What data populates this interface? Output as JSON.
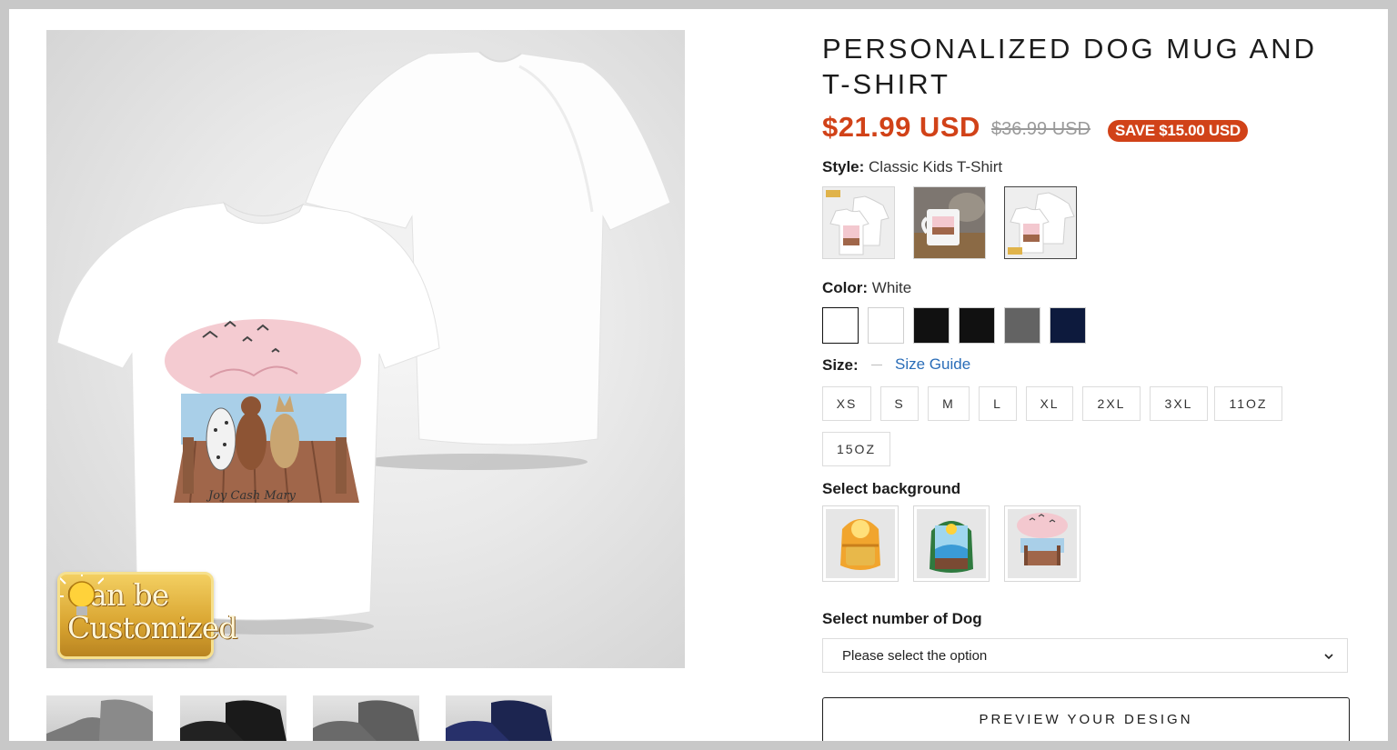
{
  "product": {
    "title": "PERSONALIZED DOG MUG AND T-SHIRT",
    "price_sale": "$21.99 USD",
    "price_compare": "$36.99 USD",
    "save_badge": "SAVE $15.00 USD"
  },
  "badge": {
    "line1": "Can be",
    "line2": "Customized"
  },
  "tshirt_art": {
    "names": "Joy Cash Mary"
  },
  "style": {
    "label": "Style:",
    "value": "Classic Kids T-Shirt",
    "options": [
      "classic-kids-t-shirt",
      "mug",
      "t-shirt-set"
    ],
    "selected_index": 2
  },
  "color": {
    "label": "Color:",
    "value": "White",
    "swatches": [
      "#ffffff",
      "#ffffff",
      "#111111",
      "#111111",
      "#636363",
      "#0d1a3d"
    ],
    "selected_index": 0
  },
  "size": {
    "label": "Size:",
    "guide_label": "Size Guide",
    "options": [
      "XS",
      "S",
      "M",
      "L",
      "XL",
      "2XL",
      "3XL",
      "11OZ",
      "15OZ"
    ]
  },
  "background": {
    "label": "Select background",
    "options": [
      "sunset-backpack",
      "mountain-lake-backpack",
      "pink-sky-dock"
    ]
  },
  "dog_count": {
    "label": "Select number of Dog",
    "placeholder": "Please select the option"
  },
  "preview_button": "PREVIEW YOUR DESIGN",
  "thumbnails": [
    "gray",
    "black",
    "dark-gray",
    "navy"
  ],
  "colors": {
    "accent_red": "#d14218",
    "link_blue": "#2a6db8"
  }
}
